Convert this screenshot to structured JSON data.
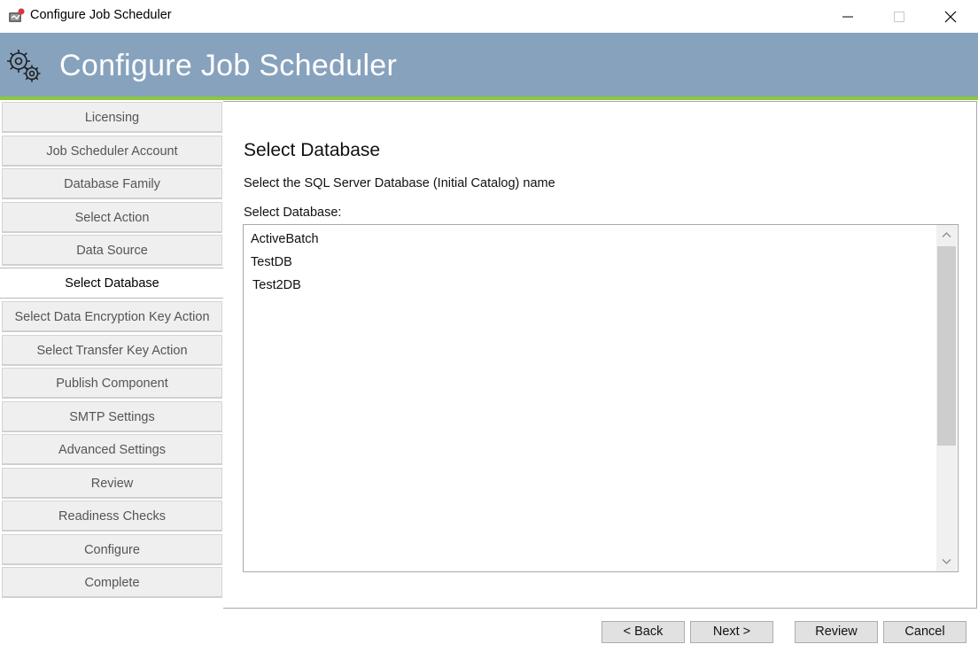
{
  "window": {
    "title": "Configure Job Scheduler"
  },
  "banner": {
    "title": "Configure Job Scheduler",
    "bg_color": "#87a2bd",
    "accent_color": "#8dc63f"
  },
  "sidebar": {
    "items": [
      {
        "label": "Licensing"
      },
      {
        "label": "Job Scheduler Account"
      },
      {
        "label": "Database Family"
      },
      {
        "label": "Select Action"
      },
      {
        "label": "Data Source"
      },
      {
        "label": "Select Database",
        "active": true
      },
      {
        "label": "Select Data Encryption Key Action"
      },
      {
        "label": "Select Transfer Key Action"
      },
      {
        "label": "Publish Component"
      },
      {
        "label": "SMTP Settings"
      },
      {
        "label": "Advanced Settings"
      },
      {
        "label": "Review"
      },
      {
        "label": "Readiness Checks"
      },
      {
        "label": "Configure"
      },
      {
        "label": "Complete"
      }
    ]
  },
  "main": {
    "title": "Select Database",
    "description": "Select the SQL Server Database (Initial Catalog) name",
    "field_label": "Select Database:",
    "databases": [
      "ActiveBatch",
      "TestDB",
      "Test2DB"
    ]
  },
  "footer": {
    "back_label": "< Back",
    "next_label": "Next >",
    "review_label": "Review",
    "cancel_label": "Cancel"
  }
}
